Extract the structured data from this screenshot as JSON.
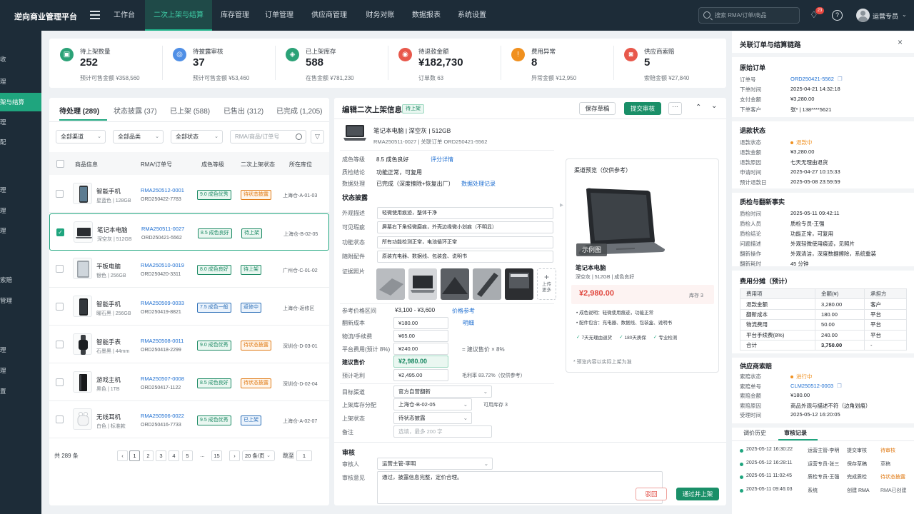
{
  "app": {
    "title": "逆向商业管理平台"
  },
  "nav": [
    "工作台",
    "二次上架与结算",
    "库存管理",
    "订单管理",
    "供应商管理",
    "财务对账",
    "数据报表",
    "系统设置"
  ],
  "topbar": {
    "search_placeholder": "搜索 RMA/订单/商品",
    "notif_count": "23",
    "user_name": "运营专员"
  },
  "sidebar": [
    "收",
    "理",
    "架与结算",
    "理",
    "配",
    "理",
    "理",
    "理",
    "索赔",
    "管理",
    "理",
    "理",
    "置"
  ],
  "stats": [
    {
      "label": "待上架数量",
      "value": "252",
      "sub": "预计可售金额 ¥358,560",
      "icon": "box-icon",
      "color": "#2ba277"
    },
    {
      "label": "待披露审核",
      "value": "37",
      "sub": "预计可售金额 ¥53,460",
      "icon": "doc-search-icon",
      "color": "#4f8fe6"
    },
    {
      "label": "已上架库存",
      "value": "588",
      "sub": "在售金额 ¥781,230",
      "icon": "tag-icon",
      "color": "#2ba277"
    },
    {
      "label": "待退款金额",
      "value": "¥182,730",
      "sub": "订单数 63",
      "icon": "refund-icon",
      "color": "#e8584b"
    },
    {
      "label": "费用异常",
      "value": "8",
      "sub": "异常金额 ¥12,950",
      "icon": "warning-icon",
      "color": "#f0901f"
    },
    {
      "label": "供应商索赔",
      "value": "5",
      "sub": "索赔金额 ¥27,840",
      "icon": "claim-icon",
      "color": "#e8584b"
    }
  ],
  "list": {
    "tabs": [
      "待处理 (289)",
      "状态披露 (37)",
      "已上架 (588)",
      "已售出 (312)",
      "已完成 (1,205)"
    ],
    "filters": [
      "全部渠道",
      "全部品类",
      "全部状态"
    ],
    "search_placeholder": "RMA/商品/订单号",
    "columns": [
      "商品信息",
      "RMA/订单号",
      "成色等级",
      "二次上架状态",
      "所在库位"
    ],
    "rows": [
      {
        "name": "智能手机",
        "spec": "星蓝色 | 128GB",
        "rma": "RMA250512-0001",
        "order": "ORD250422-7783",
        "grade": "9.0 成色优秀",
        "grade_kind": "good",
        "status": "待状态披露",
        "status_kind": "wait",
        "loc": "上海仓-A-01-03",
        "img": "phone"
      },
      {
        "name": "笔记本电脑",
        "spec": "深空灰 | 512GB",
        "rma": "RMA250511-0027",
        "order": "ORD250421-5562",
        "grade": "8.5 成色良好",
        "grade_kind": "good",
        "status": "待上架",
        "status_kind": "up",
        "loc": "上海仓-B-02-05",
        "img": "laptop"
      },
      {
        "name": "平板电脑",
        "spec": "银色 | 256GB",
        "rma": "RMA250510-0019",
        "order": "ORD250420-3311",
        "grade": "8.0 成色良好",
        "grade_kind": "good",
        "status": "待上架",
        "status_kind": "up",
        "loc": "广州仓-C-01-02",
        "img": "tablet"
      },
      {
        "name": "智能手机",
        "spec": "曜石黑 | 256GB",
        "rma": "RMA250509-0033",
        "order": "ORD250419-8821",
        "grade": "7.5 成色一般",
        "grade_kind": "norm",
        "status": "返修中",
        "status_kind": "ret",
        "loc": "上海仓-返修区",
        "img": "phone2"
      },
      {
        "name": "智能手表",
        "spec": "石墨黑 | 44mm",
        "rma": "RMA250508-0011",
        "order": "ORD250418-2299",
        "grade": "9.0 成色优秀",
        "grade_kind": "good",
        "status": "待状态披露",
        "status_kind": "wait",
        "loc": "深圳仓-D-03-01",
        "img": "watch"
      },
      {
        "name": "游戏主机",
        "spec": "黑色 | 1TB",
        "rma": "RMA250507-0008",
        "order": "ORD250417-1122",
        "grade": "8.5 成色良好",
        "grade_kind": "good",
        "status": "待状态披露",
        "status_kind": "wait",
        "loc": "深圳仓-D-02-04",
        "img": "console"
      },
      {
        "name": "无线耳机",
        "spec": "白色 | 标准款",
        "rma": "RMA250506-0022",
        "order": "ORD250416-7733",
        "grade": "9.5 成色优秀",
        "grade_kind": "good",
        "status": "已上架",
        "status_kind": "ret",
        "loc": "上海仓-A-02-07",
        "img": "buds"
      }
    ],
    "total": "共 289 条",
    "pages": [
      "1",
      "2",
      "3",
      "4",
      "5",
      "...",
      "15"
    ],
    "page_size": "20 条/页",
    "jump_label": "跳至",
    "jump_value": "1"
  },
  "edit": {
    "title": "编辑二次上架信息",
    "status_tag": "待上架",
    "btn_draft": "保存草稿",
    "btn_submit": "提交审核",
    "product_title": "笔记本电脑 | 深空灰 | 512GB",
    "product_ids": "RMA250511-0027 | 关联订单 ORD250421-5562",
    "grade_label": "成色等级",
    "grade_value": "8.5 成色良好",
    "grade_link": "评分详情",
    "qc_label": "质检结论",
    "qc_value": "功能正常，可复用",
    "data_label": "数据处理",
    "data_value": "已完成（深度擦除+恢复出厂）",
    "data_link": "数据处理记录",
    "disclosure_title": "状态披露",
    "disclosure": [
      {
        "label": "外观描述",
        "value": "轻微使用痕迹，整体干净"
      },
      {
        "label": "可见瑕疵",
        "value": "屏幕右下角轻微磨痕，外壳边缘微小划痕（不明显）"
      },
      {
        "label": "功能状态",
        "value": "所有功能检测正常，电池循环正常"
      },
      {
        "label": "随附配件",
        "value": "原装充电器、数据线、包装盒、说明书"
      }
    ],
    "photos_label": "证据照片",
    "photo_more": "上传更多",
    "price_ref_label": "参考价格区间",
    "price_ref_value": "¥3,100 - ¥3,600",
    "price_ref_link": "价格参考",
    "refurb_label": "翻新成本",
    "refurb_value": "¥180.00",
    "refurb_link": "明细",
    "ship_label": "物流/手续费",
    "ship_value": "¥65.00",
    "platform_label": "平台费用(预计 8%)",
    "platform_value": "¥240.00",
    "platform_note": "= 建议售价 × 8%",
    "price_label": "建议售价",
    "price_value": "¥2,980.00",
    "profit_label": "预计毛利",
    "profit_value": "¥2,495.00",
    "profit_note": "毛利率 83.72%（仅供参考）",
    "channel_label": "目标渠道",
    "channel_value": "官方自营翻新",
    "stock_label": "上架库存分配",
    "stock_value": "上海仓-B-02-05",
    "stock_note": "可用库存 3",
    "state_label": "上架状态",
    "state_value": "待状态披露",
    "remark_label": "备注",
    "remark_placeholder": "选填，最多 200 字",
    "review_title": "审核",
    "reviewer_label": "审核人",
    "reviewer_value": "运营主管-李明",
    "opinion_label": "审核意见",
    "opinion_value": "通过，披露信息完整，定价合理。",
    "btn_reject": "驳回",
    "btn_pass": "通过并上架"
  },
  "preview": {
    "title": "渠道预览（仅供参考）",
    "badge": "示例图",
    "name": "笔记本电脑",
    "spec": "深空灰 | 512GB | 成色良好",
    "price": "¥2,980.00",
    "stock": "库存 3",
    "bullets": [
      "成色说明：轻微使用痕迹，功能正常",
      "配件包含：充电器、数据线、包装盒、说明书"
    ],
    "badges": [
      "7天无理由退货",
      "180天质保",
      "专业检测"
    ],
    "footer": "* 预览内容以实际上架为准"
  },
  "right": {
    "title": "关联订单与结算链路",
    "sections": [
      {
        "title": "原始订单",
        "rows": [
          {
            "k": "订单号",
            "v": "ORD250421-5562",
            "link": true
          },
          {
            "k": "下单时间",
            "v": "2025-04-21 14:32:18"
          },
          {
            "k": "支付金额",
            "v": "¥3,280.00"
          },
          {
            "k": "下单客户",
            "v": "张* | 138****5621"
          }
        ]
      },
      {
        "title": "退款状态",
        "rows": [
          {
            "k": "退款状态",
            "v": "退款中",
            "dot": "#f0901f"
          },
          {
            "k": "退款金额",
            "v": "¥3,280.00"
          },
          {
            "k": "退款原因",
            "v": "七天无理由退货"
          },
          {
            "k": "申请时间",
            "v": "2025-04-27 10:15:33"
          },
          {
            "k": "预计退款日",
            "v": "2025-05-08 23:59:59"
          }
        ]
      },
      {
        "title": "质检与翻新事实",
        "rows": [
          {
            "k": "质检时间",
            "v": "2025-05-11 09:42:11"
          },
          {
            "k": "质检人员",
            "v": "质检专员-王强"
          },
          {
            "k": "质检结论",
            "v": "功能正常，可复用"
          },
          {
            "k": "问题描述",
            "v": "外观轻微使用痕迹，见照片"
          },
          {
            "k": "翻新操作",
            "v": "外观清洁，深度数据擦除，系统重装"
          },
          {
            "k": "翻新耗时",
            "v": "45 分钟"
          }
        ]
      }
    ],
    "fee_title": "费用分摊（预计）",
    "fee_cols": [
      "费用项",
      "金额(¥)",
      "承担方"
    ],
    "fee_rows": [
      [
        "退款金额",
        "3,280.00",
        "客户"
      ],
      [
        "翻新成本",
        "180.00",
        "平台"
      ],
      [
        "物流费用",
        "50.00",
        "平台"
      ],
      [
        "平台手续费(8%)",
        "240.00",
        "平台"
      ],
      [
        "合计",
        "3,750.00",
        "-"
      ]
    ],
    "claim_title": "供应商索赔",
    "claim_rows": [
      {
        "k": "索赔状态",
        "v": "进行中",
        "dot": "#f0901f"
      },
      {
        "k": "索赔单号",
        "v": "CLM250512-0003",
        "link": true
      },
      {
        "k": "索赔金额",
        "v": "¥180.00"
      },
      {
        "k": "索赔原因",
        "v": "商品外观与描述不符（边角划痕）"
      },
      {
        "k": "受理时间",
        "v": "2025-05-12 16:20:05"
      }
    ],
    "tabs": [
      "调价历史",
      "审核记录"
    ],
    "logs": [
      {
        "time": "2025-05-12 16:30:22",
        "actor": "运营主管-李明",
        "action": "提交审核",
        "status": "待审核",
        "color": "#e07b16"
      },
      {
        "time": "2025-05-12 16:28:11",
        "actor": "运营专员-张三",
        "action": "保存草稿",
        "status": "草稿",
        "color": "#5b6168"
      },
      {
        "time": "2025-05-11 11:02:45",
        "actor": "质检专员-王强",
        "action": "完成质检",
        "status": "待状态披露",
        "color": "#e07b16"
      },
      {
        "time": "2025-05-11 09:46:03",
        "actor": "系统",
        "action": "创建 RMA",
        "status": "RMA已创建",
        "color": "#5b6168"
      }
    ]
  }
}
